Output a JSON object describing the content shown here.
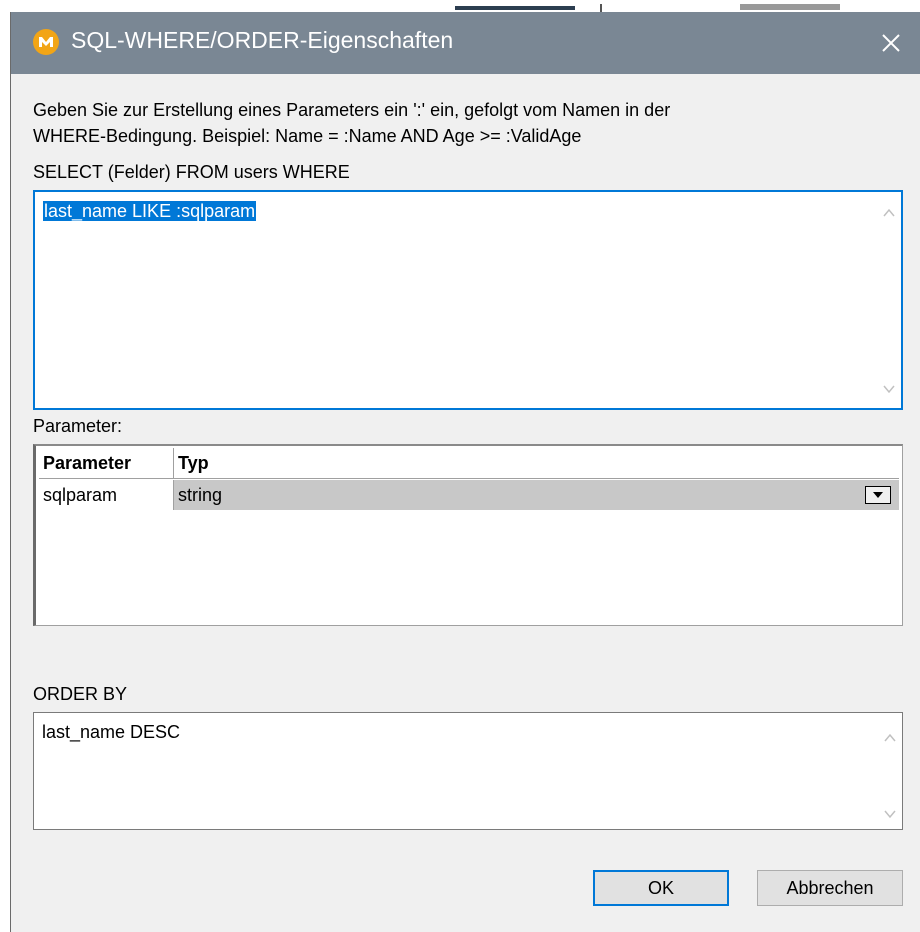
{
  "window": {
    "title": "SQL-WHERE/ORDER-Eigenschaften"
  },
  "instructions": {
    "line1": "Geben Sie zur Erstellung eines Parameters ein ':' ein, gefolgt vom Namen in der",
    "line2": "WHERE-Bedingung. Beispiel:  Name = :Name AND Age >= :ValidAge"
  },
  "where": {
    "label": "SELECT (Felder) FROM users WHERE",
    "value": "last_name LIKE :sqlparam"
  },
  "parameters": {
    "label": "Parameter:",
    "columns": [
      "Parameter",
      "Typ"
    ],
    "rows": [
      {
        "parameter": "sqlparam",
        "type": "string"
      }
    ]
  },
  "order": {
    "label": "ORDER BY",
    "value": "last_name DESC"
  },
  "buttons": {
    "ok": "OK",
    "cancel": "Abbrechen"
  },
  "colors": {
    "titlebar": "#7a8794",
    "accent": "#0078d7",
    "selected_row": "#c8c8c8"
  }
}
